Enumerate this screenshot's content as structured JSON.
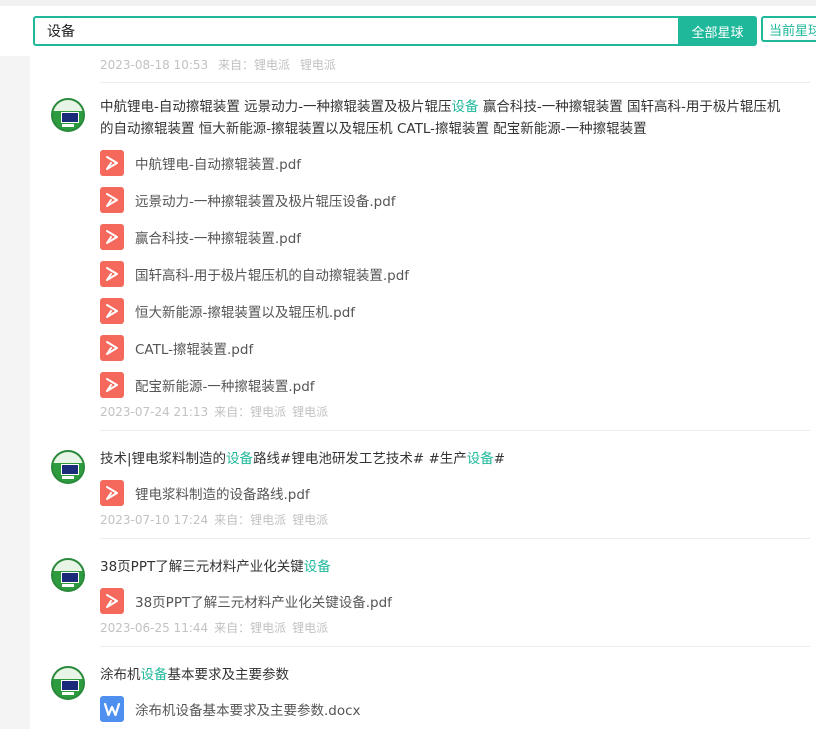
{
  "search": {
    "query": "设备",
    "all_label": "全部星球",
    "current_label": "当前星球"
  },
  "colors": {
    "accent": "#1fb89b",
    "pdf": "#f4695c",
    "docx": "#4f8ff0"
  },
  "first_meta": {
    "date": "2023-08-18 10:53",
    "from": "来自：锂电派",
    "author": "锂电派"
  },
  "posts": [
    {
      "title": [
        {
          "t": "中航锂电-自动擦辊装置 远景动力-一种擦辊装置及极片辊压"
        },
        {
          "t": "设备",
          "hl": true
        },
        {
          "t": " 赢合科技-一种擦辊装置 国轩高科-用于极片辊压机的自动擦辊装置 恒大新能源-擦辊装置以及辊压机 CATL-擦辊装置 配宝新能源-一种擦辊装置"
        }
      ],
      "files": [
        {
          "name": "中航锂电-自动擦辊装置.pdf",
          "type": "pdf"
        },
        {
          "name": "远景动力-一种擦辊装置及极片辊压设备.pdf",
          "type": "pdf"
        },
        {
          "name": "赢合科技-一种擦辊装置.pdf",
          "type": "pdf"
        },
        {
          "name": "国轩高科-用于极片辊压机的自动擦辊装置.pdf",
          "type": "pdf"
        },
        {
          "name": "恒大新能源-擦辊装置以及辊压机.pdf",
          "type": "pdf"
        },
        {
          "name": "CATL-擦辊装置.pdf",
          "type": "pdf"
        },
        {
          "name": "配宝新能源-一种擦辊装置.pdf",
          "type": "pdf"
        }
      ],
      "date": "2023-07-24 21:13",
      "from": "来自：锂电派",
      "author": "锂电派"
    },
    {
      "title": [
        {
          "t": "技术|锂电浆料制造的"
        },
        {
          "t": "设备",
          "hl": true
        },
        {
          "t": "路线#锂电池研发工艺技术# #生产"
        },
        {
          "t": "设备",
          "hl": true
        },
        {
          "t": "#"
        }
      ],
      "files": [
        {
          "name": "锂电浆料制造的设备路线.pdf",
          "type": "pdf"
        }
      ],
      "date": "2023-07-10 17:24",
      "from": "来自：锂电派",
      "author": "锂电派"
    },
    {
      "title": [
        {
          "t": "38页PPT了解三元材料产业化关键"
        },
        {
          "t": "设备",
          "hl": true
        }
      ],
      "files": [
        {
          "name": "38页PPT了解三元材料产业化关键设备.pdf",
          "type": "pdf"
        }
      ],
      "date": "2023-06-25 11:44",
      "from": "来自：锂电派",
      "author": "锂电派"
    },
    {
      "title": [
        {
          "t": "涂布机"
        },
        {
          "t": "设备",
          "hl": true
        },
        {
          "t": "基本要求及主要参数"
        }
      ],
      "files": [
        {
          "name": "涂布机设备基本要求及主要参数.docx",
          "type": "docx"
        }
      ]
    }
  ]
}
